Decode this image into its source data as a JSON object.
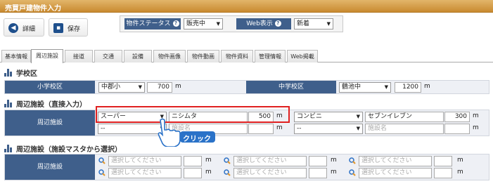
{
  "window": {
    "title": "売買戸建物件入力"
  },
  "toolbar": {
    "detail_label": "詳細",
    "save_label": "保存"
  },
  "status": {
    "property_status_label": "物件ステータス",
    "property_status_value": "販売中",
    "web_display_label": "Web表示",
    "web_display_value": "新着"
  },
  "tabs": [
    "基本情報",
    "周辺施設",
    "接道",
    "交通",
    "設備",
    "物件画像",
    "物件動画",
    "物件資料",
    "管理情報",
    "Web掲載"
  ],
  "school": {
    "heading": "学校区",
    "elementary_label": "小学校区",
    "elementary_value": "中郡小",
    "elementary_distance": "700",
    "junior_label": "中学校区",
    "junior_value": "鶴池中",
    "junior_distance": "1200",
    "unit": "m"
  },
  "facilities_direct": {
    "heading": "周辺施設（直接入力）",
    "row_label": "周辺施設",
    "unit": "m",
    "row1": {
      "type1": "スーパー",
      "name1": "ニシムタ",
      "dist1": "500",
      "type2": "コンビニ",
      "name2": "セブンイレブン",
      "dist2": "300"
    },
    "row2": {
      "type1": "--",
      "name1_placeholder": "施設名",
      "dist1": "",
      "type2": "--",
      "name2_placeholder": "施設名",
      "dist2": ""
    }
  },
  "click_annotation": "クリック",
  "facilities_master": {
    "heading": "周辺施設（施設マスタから選択）",
    "row_label": "周辺施設",
    "placeholder": "選択してください",
    "unit": "m"
  },
  "colors": {
    "header_blue": "#3f5f8b",
    "title_orange": "#d49a45",
    "highlight_red": "#e02020",
    "callout_blue": "#2a72c8"
  }
}
